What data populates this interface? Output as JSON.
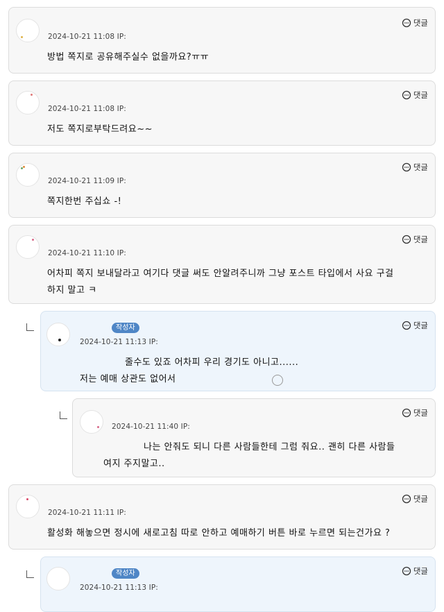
{
  "reply_label": "댓글",
  "comments": [
    {
      "timestamp": "2024-10-21 11:08 IP:",
      "text": "방법 쪽지로 공유해주실수 없을까요?ㅠㅠ"
    },
    {
      "timestamp": "2024-10-21 11:08 IP:",
      "text": "저도 쪽지로부탁드려요~~"
    },
    {
      "timestamp": "2024-10-21 11:09 IP:",
      "text": "쪽지한번 주십쇼 -!"
    },
    {
      "timestamp": "2024-10-21 11:10 IP:",
      "text_line1": "어차피 쪽지 보내달라고 여기다 댓글 써도 안알려주니까 그냥 포스트 타입에서 사요 구걸",
      "text_line2": "하지 말고 ㅋ"
    },
    {
      "badge": "작성자",
      "timestamp": "2024-10-21 11:13 IP:",
      "text_line1": "줄수도 있죠 어차피 우리 경기도 아니고......",
      "text_line2": "저는 예매 상관도 없어서"
    },
    {
      "timestamp": "2024-10-21 11:40 IP:",
      "text_line1": "나는 안줘도 되니 다른 사람들한테 그럼 줘요.. 괜히 다른 사람들",
      "text_line2": "여지 주지말고.."
    },
    {
      "timestamp": "2024-10-21 11:11 IP:",
      "text": "활성화 해놓으면 정시에 새로고침 따로 안하고 예매하기 버튼 바로 누르면 되는건가요 ?"
    },
    {
      "badge": "작성자",
      "timestamp": "2024-10-21 11:13 IP:"
    }
  ]
}
